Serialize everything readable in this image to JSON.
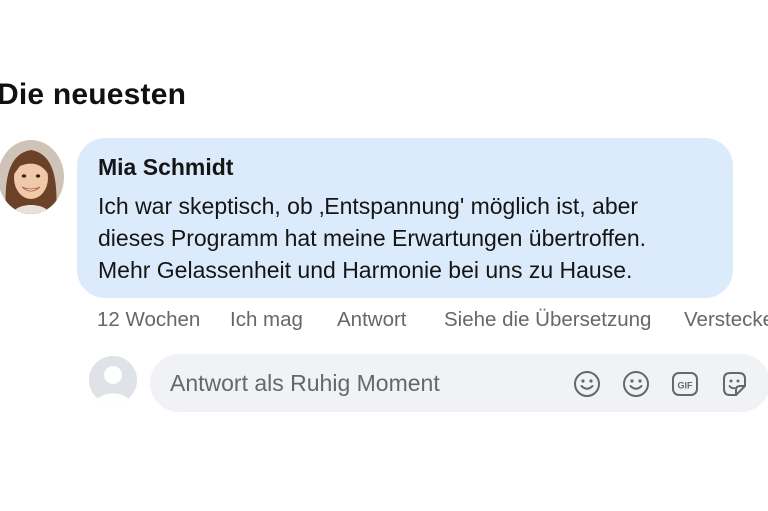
{
  "section": {
    "title": "Die neuesten"
  },
  "comment": {
    "author": "Mia Schmidt",
    "lines": [
      "Ich war skeptisch, ob ‚Entspannung' möglich ist, aber",
      "dieses Programm hat meine Erwartungen übertroffen.",
      "Mehr Gelassenheit und Harmonie bei uns zu Hause."
    ],
    "actions": {
      "time": "12 Wochen",
      "like": "Ich mag",
      "reply": "Antwort",
      "translate": "Siehe die Übersetzung",
      "hide": "Verstecken"
    }
  },
  "reply": {
    "placeholder": "Antwort als Ruhig Moment",
    "icons": [
      "smiley-icon",
      "emoji-icon",
      "gif-icon",
      "sticker-icon"
    ]
  },
  "colors": {
    "bubble": "#dcebfb",
    "reply_box": "#f0f2f5",
    "secondary_text": "#65676b"
  }
}
